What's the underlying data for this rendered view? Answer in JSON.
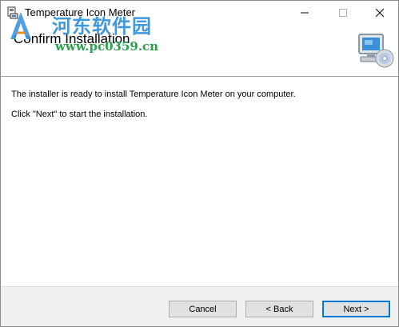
{
  "window": {
    "title": "Temperature Icon Meter",
    "minimize_glyph": "—",
    "maximize_glyph": "☐",
    "close_glyph": "✕"
  },
  "header": {
    "title": "Confirm Installation",
    "icon": "computer-cd-icon"
  },
  "watermark": {
    "text_cn": "河东软件园",
    "url": "www.pc0359.cn"
  },
  "content": {
    "line1": "The installer is ready to install Temperature Icon Meter on your computer.",
    "line2": "Click \"Next\" to start the installation."
  },
  "buttons": {
    "cancel": "Cancel",
    "back": "< Back",
    "next": "Next >"
  },
  "colors": {
    "accent": "#0078d7",
    "watermark_blue": "#2f8fdc",
    "watermark_green": "#2aa04a"
  }
}
